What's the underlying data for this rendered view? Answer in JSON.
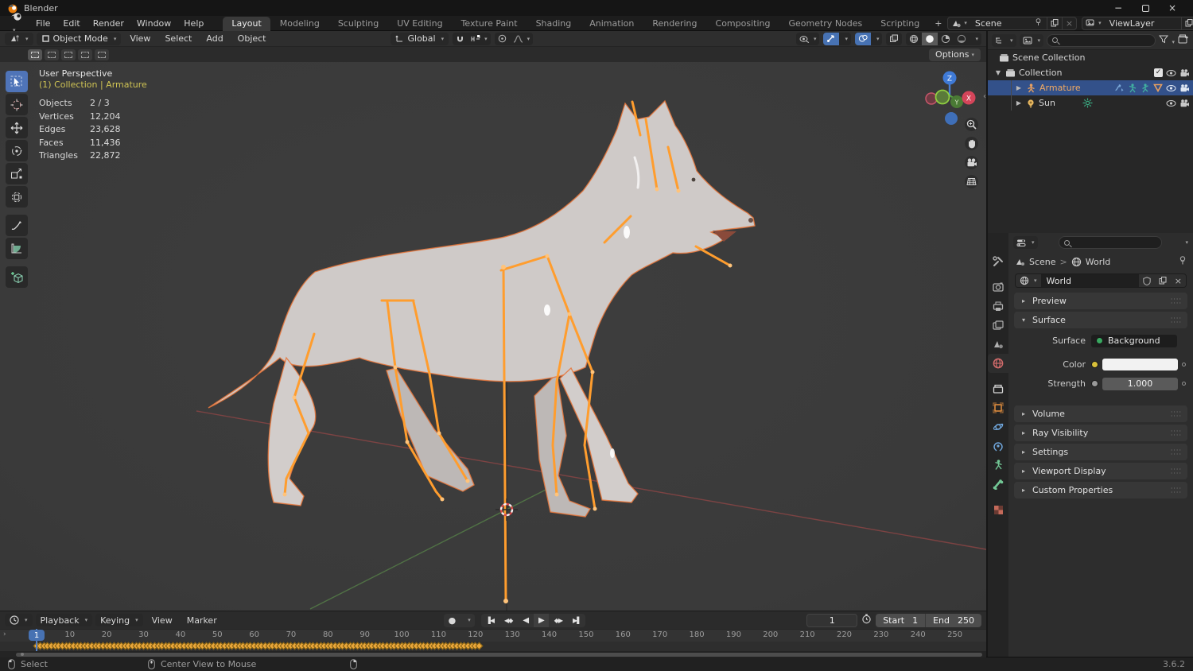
{
  "titlebar": {
    "app": "Blender",
    "minimize": "−",
    "close": "×"
  },
  "topbar": {
    "menus": [
      "File",
      "Edit",
      "Render",
      "Window",
      "Help"
    ],
    "tabs": [
      {
        "label": "Layout"
      },
      {
        "label": "Modeling"
      },
      {
        "label": "Sculpting"
      },
      {
        "label": "UV Editing"
      },
      {
        "label": "Texture Paint"
      },
      {
        "label": "Shading"
      },
      {
        "label": "Animation"
      },
      {
        "label": "Rendering"
      },
      {
        "label": "Compositing"
      },
      {
        "label": "Geometry Nodes"
      },
      {
        "label": "Scripting"
      }
    ],
    "new_tab": "+",
    "scene_picker": {
      "value": "Scene"
    },
    "view_layer_picker": {
      "value": "ViewLayer"
    }
  },
  "viewport_header": {
    "mode": "Object Mode",
    "menus": [
      "View",
      "Select",
      "Add",
      "Object"
    ],
    "orientation": "Global",
    "options": "Options"
  },
  "viewport": {
    "info": {
      "view": "User Perspective",
      "context": "(1) Collection | Armature",
      "stats": [
        {
          "label": "Objects",
          "value": "2 / 3"
        },
        {
          "label": "Vertices",
          "value": "12,204"
        },
        {
          "label": "Edges",
          "value": "23,628"
        },
        {
          "label": "Faces",
          "value": "11,436"
        },
        {
          "label": "Triangles",
          "value": "22,872"
        }
      ]
    },
    "gizmo": {
      "z": "Z",
      "y": "Y",
      "x": "X"
    }
  },
  "outliner": {
    "rows": [
      {
        "label": "Scene Collection"
      },
      {
        "label": "Collection"
      },
      {
        "label": "Armature"
      },
      {
        "label": "Sun"
      }
    ]
  },
  "properties": {
    "path": {
      "scene": "Scene",
      "separator": ">",
      "world": "World"
    },
    "datablock": {
      "name": "World"
    },
    "panels": {
      "preview": "Preview",
      "surface": "Surface",
      "volume": "Volume",
      "ray_visibility": "Ray Visibility",
      "settings": "Settings",
      "viewport_display": "Viewport Display",
      "custom_properties": "Custom Properties"
    },
    "surface": {
      "surface_label": "Surface",
      "surface_value": "Background",
      "color_label": "Color",
      "strength_label": "Strength",
      "strength_value": "1.000"
    }
  },
  "timeline": {
    "menus": [
      "Playback",
      "Keying",
      "View",
      "Marker"
    ],
    "current_frame": 1,
    "frame_field": "1",
    "start_label": "Start",
    "start_value": "1",
    "end_label": "End",
    "end_value": "250",
    "ruler_ticks": [
      10,
      20,
      30,
      40,
      50,
      60,
      70,
      80,
      90,
      100,
      110,
      120,
      130,
      140,
      150,
      160,
      170,
      180,
      190,
      200,
      210,
      220,
      230,
      240,
      250
    ],
    "keyframes": {
      "first": 1,
      "last": 121
    }
  },
  "statusbar": {
    "lmb": "Select",
    "mmb": "Center View to Mouse",
    "rmb": "",
    "version": "3.6.2"
  }
}
